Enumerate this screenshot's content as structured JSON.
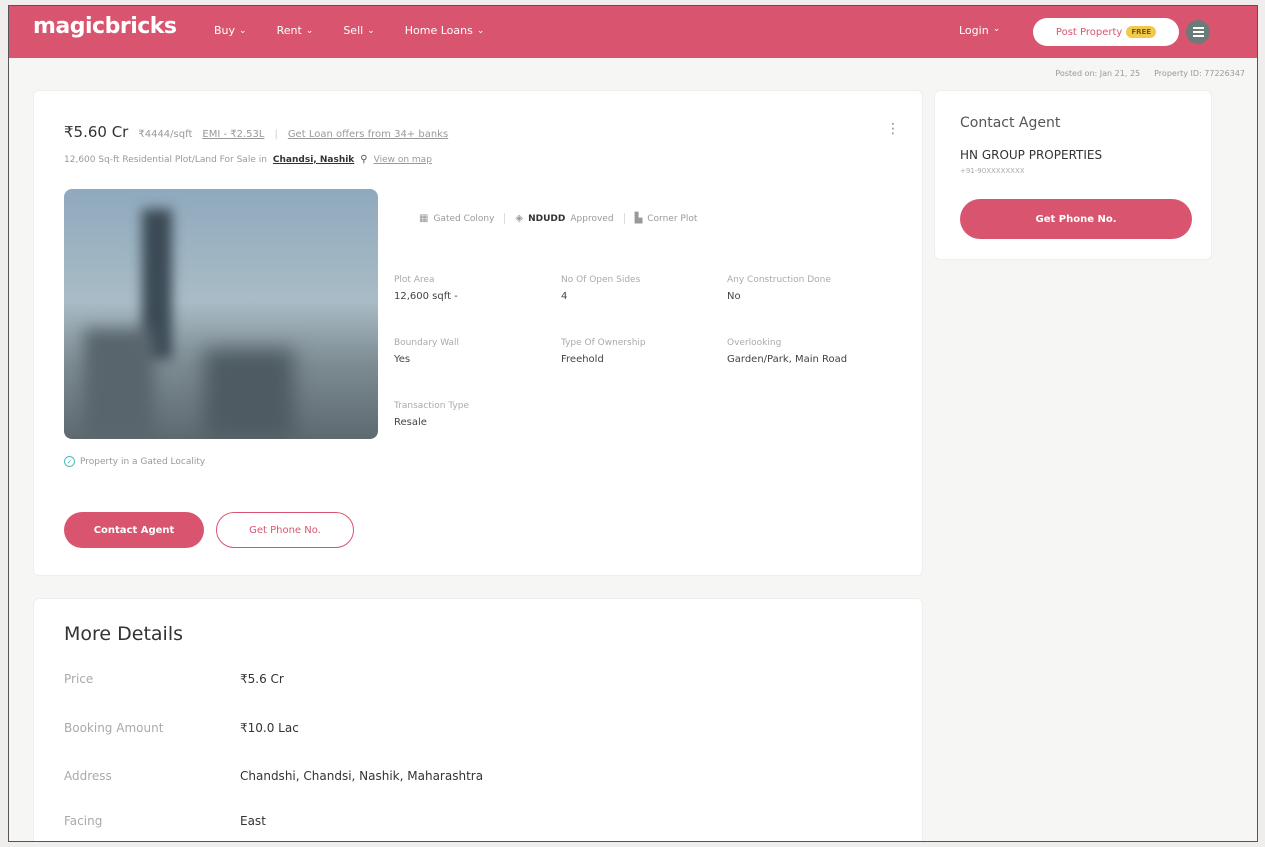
{
  "header": {
    "logo": "magicbricks",
    "nav": [
      {
        "label": "Buy"
      },
      {
        "label": "Rent"
      },
      {
        "label": "Sell"
      },
      {
        "label": "Home Loans"
      }
    ],
    "login": "Login",
    "post_property": "Post Property",
    "post_badge": "FREE"
  },
  "meta": {
    "posted_on": "Posted on: Jan 21, 25",
    "property_id": "Property ID: 77226347"
  },
  "listing": {
    "price": "₹5.60 Cr",
    "rate": "₹4444/sqft",
    "emi": "EMI - ₹2.53L",
    "loan_link": "Get Loan offers from 34+ banks",
    "subtitle_prefix": "12,600 Sq-ft Residential Plot/Land For Sale in",
    "location": "Chandsi, Nashik",
    "view_on_map": "View on map",
    "features": [
      {
        "label": "Gated Colony",
        "icon": "building-icon"
      },
      {
        "label": "NDUDD",
        "label2": "Approved",
        "icon": "shield-check-icon"
      },
      {
        "label": "Corner Plot",
        "icon": "corner-icon"
      }
    ],
    "attributes": [
      {
        "label": "Plot Area",
        "value": "12,600 sqft -"
      },
      {
        "label": "No Of Open Sides",
        "value": "4"
      },
      {
        "label": "Any Construction Done",
        "value": "No"
      },
      {
        "label": "Boundary Wall",
        "value": "Yes"
      },
      {
        "label": "Type Of Ownership",
        "value": "Freehold"
      },
      {
        "label": "Overlooking",
        "value": "Garden/Park, Main Road"
      },
      {
        "label": "Transaction Type",
        "value": "Resale"
      }
    ],
    "gated_note": "Property in a Gated Locality",
    "contact_btn": "Contact Agent",
    "phone_btn": "Get Phone No."
  },
  "contact": {
    "title": "Contact Agent",
    "agent_name": "HN GROUP PROPERTIES",
    "agent_phone": "+91-90XXXXXXXX",
    "button": "Get Phone No."
  },
  "more_details": {
    "title": "More Details",
    "rows": [
      {
        "label": "Price",
        "value": "₹5.6 Cr"
      },
      {
        "label": "Booking Amount",
        "value": "₹10.0 Lac"
      },
      {
        "label": "Address",
        "value": "Chandshi, Chandsi, Nashik, Maharashtra"
      },
      {
        "label": "Facing",
        "value": "East"
      }
    ]
  },
  "colors": {
    "brand": "#d9556f",
    "badge": "#f2c94c"
  }
}
